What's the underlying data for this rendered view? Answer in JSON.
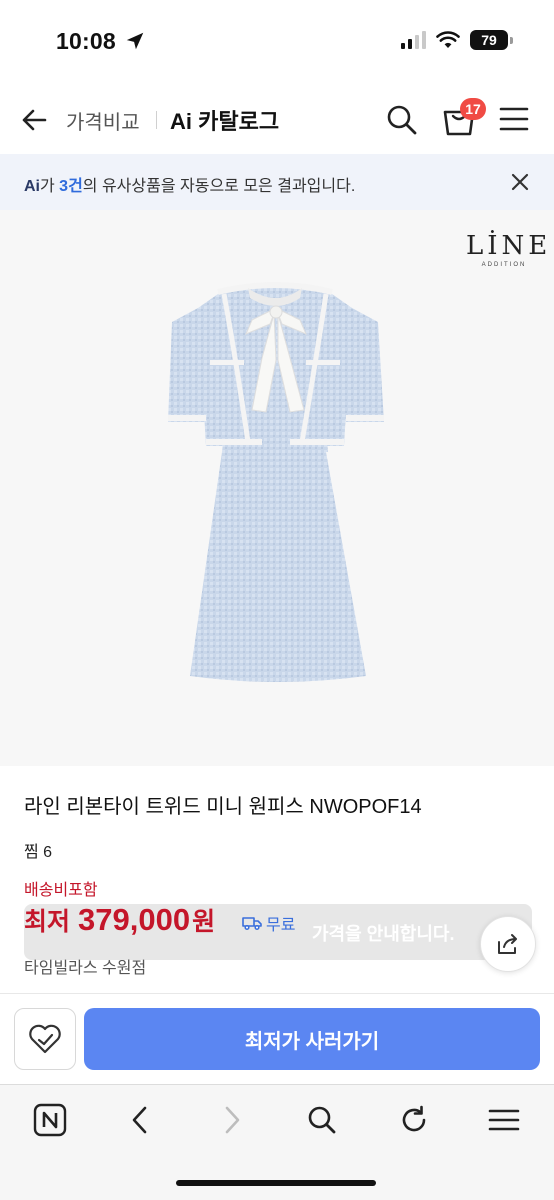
{
  "status_bar": {
    "time": "10:08",
    "battery": "79"
  },
  "header": {
    "back_icon": "arrow-left-icon",
    "breadcrumb": "가격비교",
    "title": "Ai 카탈로그",
    "cart_count": "17",
    "icons": [
      "search-icon",
      "shopping-bag-icon",
      "hamburger-menu-icon"
    ]
  },
  "ai_banner": {
    "prefix": "Ai",
    "mid1": "가 ",
    "count": "3건",
    "suffix": "의 유사상품을 자동으로 모은 결과입니다."
  },
  "product": {
    "brand_logo": "LİNE",
    "brand_logo_sub": "ADDITION",
    "name": "라인 리본타이 트위드 미니 원피스 NWOPOF14",
    "wish_count": "찜 6",
    "shipping_note": "배송비포함",
    "price_label": "최저",
    "price": "379,000",
    "price_unit": "원",
    "free_shipping": "무료",
    "seller": "타임빌라스 수원점"
  },
  "toast": {
    "text": "가격을 안내합니다."
  },
  "actions": {
    "buy_label": "최저가 사러가기"
  },
  "browser_bar": {
    "icons": [
      "n-tab-icon",
      "back-icon",
      "forward-icon",
      "search-icon",
      "refresh-icon",
      "menu-icon"
    ]
  },
  "colors": {
    "accent": "#5b86f2",
    "price": "#c4162a",
    "badge": "#f04b44",
    "banner_bg": "#f0f3fa"
  }
}
